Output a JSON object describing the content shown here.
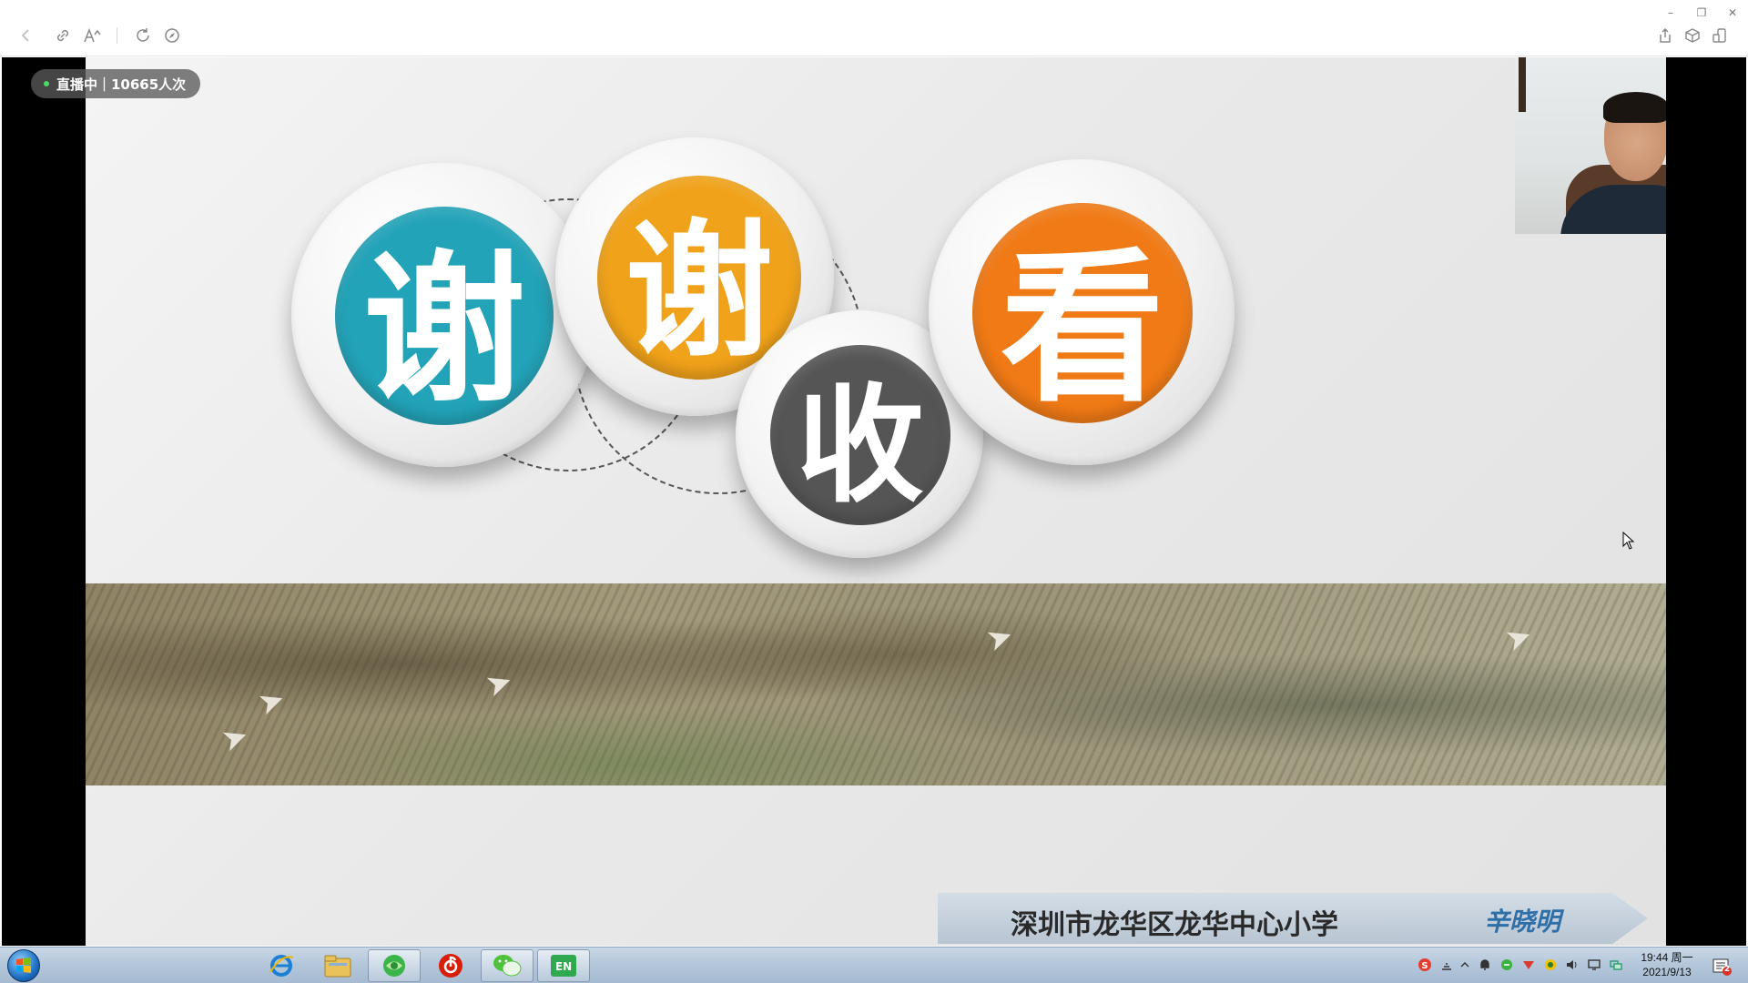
{
  "live_badge": {
    "text": "直播中｜10665人次"
  },
  "slide": {
    "char1": "谢",
    "char2": "谢",
    "char3": "收",
    "char4": "看",
    "colors": {
      "teal": "#23a3b8",
      "amber": "#f0a21a",
      "gray": "#555555",
      "orange": "#f07a16"
    },
    "banner_school": "深圳市龙华区龙华中心小学",
    "banner_name": "辛晓明"
  },
  "toolbar": {
    "icons": [
      "back-icon",
      "link-icon",
      "font-icon",
      "refresh-icon",
      "compass-icon",
      "share-icon",
      "cube-icon",
      "phone-icon"
    ]
  },
  "window_controls": {
    "minimize": "–",
    "restore": "❐",
    "close": "✕"
  },
  "taskbar": {
    "apps": [
      "internet-explorer-icon",
      "file-explorer-icon",
      "browser-icon",
      "netease-music-icon",
      "wechat-icon",
      "en-app-icon"
    ],
    "clock_time": "19:44 周一",
    "clock_date": "2021/9/13",
    "notify_count": "2"
  }
}
